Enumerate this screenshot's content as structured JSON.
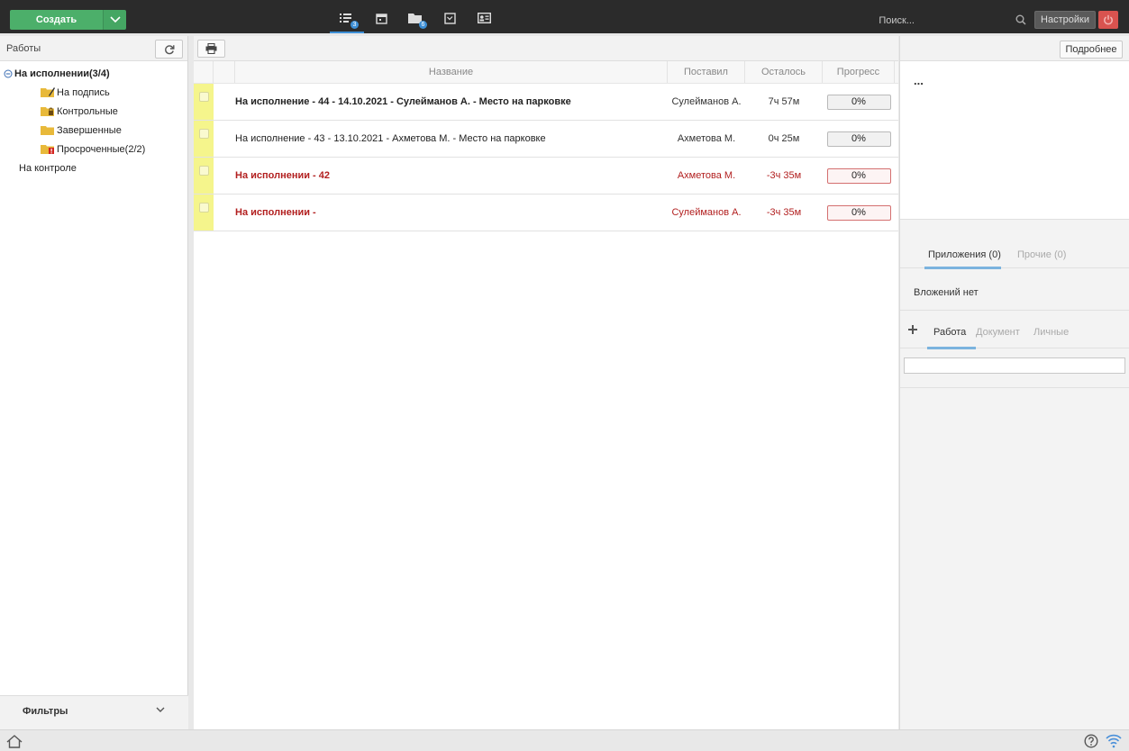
{
  "topbar": {
    "create_label": "Создать",
    "nav_badges": {
      "tasks": "3",
      "folders": "6"
    },
    "search_placeholder": "Поиск...",
    "settings_label": "Настройки"
  },
  "left": {
    "title": "Работы",
    "tree": [
      {
        "label": "На исполнении(3/4)",
        "level": 0,
        "bold": true,
        "icon": "minus-circle-icon"
      },
      {
        "label": "На подпись",
        "level": 1,
        "icon": "folder-pen-icon"
      },
      {
        "label": "Контрольные",
        "level": 1,
        "icon": "folder-lock-icon"
      },
      {
        "label": "Завершенные",
        "level": 1,
        "icon": "folder-icon"
      },
      {
        "label": "Просроченные(2/2)",
        "level": 1,
        "icon": "folder-alert-icon"
      },
      {
        "label": "На контроле",
        "level": 0,
        "icon": ""
      }
    ],
    "filters_label": "Фильтры"
  },
  "table": {
    "columns": {
      "name": "Название",
      "by": "Поставил",
      "left": "Осталось",
      "progress": "Прогресс"
    },
    "rows": [
      {
        "name": "На исполнение - 44 - 14.10.2021 - Сулейманов А. - Место на парковке",
        "by": "Сулейманов А.",
        "left": "7ч 57м",
        "progress": "0%",
        "style": "bold"
      },
      {
        "name": "На исполнение - 43 - 13.10.2021 - Ахметова М. - Место на парковке",
        "by": "Ахметова М.",
        "left": "0ч 25м",
        "progress": "0%",
        "style": "normal"
      },
      {
        "name": "На исполнении - 42",
        "by": "Ахметова М.",
        "left": "-3ч 35м",
        "progress": "0%",
        "style": "red"
      },
      {
        "name": "На исполнении -",
        "by": "Сулейманов А.",
        "left": "-3ч 35м",
        "progress": "0%",
        "style": "red"
      }
    ]
  },
  "right": {
    "more_label": "Подробнее",
    "info_title": "...",
    "attach_tabs": {
      "apps": "Приложения (0)",
      "other": "Прочие (0)"
    },
    "attach_empty": "Вложений нет",
    "comment_tabs": {
      "work": "Работа",
      "document": "Документ",
      "personal": "Личные"
    }
  },
  "colors": {
    "accent_green": "#4caf6a",
    "accent_blue": "#3d8fd6",
    "overdue_red": "#b21f1f",
    "row_marker_yellow": "#f5f58c"
  }
}
